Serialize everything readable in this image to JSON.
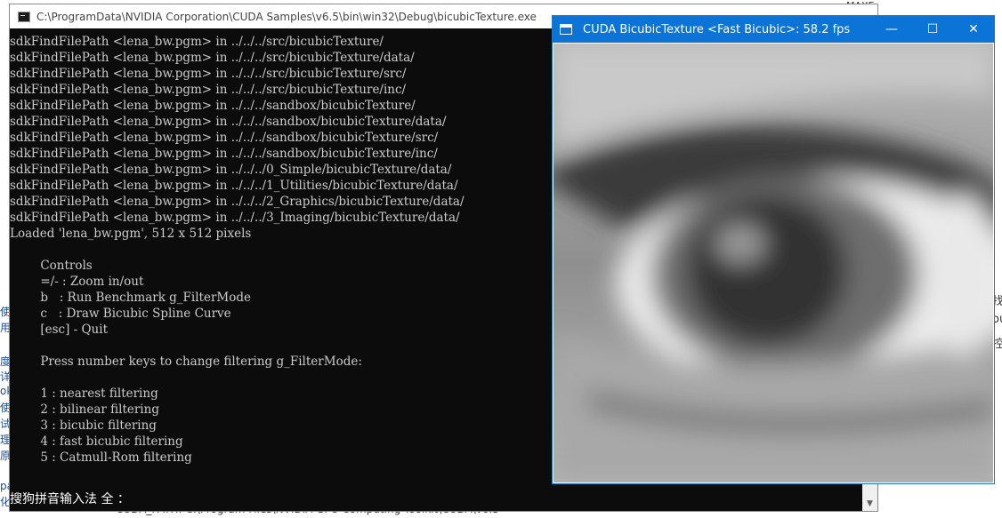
{
  "console": {
    "title": "C:\\ProgramData\\NVIDIA Corporation\\CUDA Samples\\v6.5\\bin\\win32\\Debug\\bicubicTexture.exe",
    "lines": [
      "sdkFindFilePath <lena_bw.pgm> in ../../../src/bicubicTexture/",
      "sdkFindFilePath <lena_bw.pgm> in ../../../src/bicubicTexture/data/",
      "sdkFindFilePath <lena_bw.pgm> in ../../../src/bicubicTexture/src/",
      "sdkFindFilePath <lena_bw.pgm> in ../../../src/bicubicTexture/inc/",
      "sdkFindFilePath <lena_bw.pgm> in ../../../sandbox/bicubicTexture/",
      "sdkFindFilePath <lena_bw.pgm> in ../../../sandbox/bicubicTexture/data/",
      "sdkFindFilePath <lena_bw.pgm> in ../../../sandbox/bicubicTexture/src/",
      "sdkFindFilePath <lena_bw.pgm> in ../../../sandbox/bicubicTexture/inc/",
      "sdkFindFilePath <lena_bw.pgm> in ../../../0_Simple/bicubicTexture/data/",
      "sdkFindFilePath <lena_bw.pgm> in ../../../1_Utilities/bicubicTexture/data/",
      "sdkFindFilePath <lena_bw.pgm> in ../../../2_Graphics/bicubicTexture/data/",
      "sdkFindFilePath <lena_bw.pgm> in ../../../3_Imaging/bicubicTexture/data/",
      "Loaded 'lena_bw.pgm', 512 x 512 pixels",
      "",
      "        Controls",
      "        =/- : Zoom in/out",
      "        b   : Run Benchmark g_FilterMode",
      "        c   : Draw Bicubic Spline Curve",
      "        [esc] - Quit",
      "",
      "        Press number keys to change filtering g_FilterMode:",
      "",
      "        1 : nearest filtering",
      "        2 : bilinear filtering",
      "        3 : bicubic filtering",
      "        4 : fast bicubic filtering",
      "        5 : Catmull-Rom filtering"
    ],
    "ime_status": "搜狗拼音输入法 全 ："
  },
  "cuda_window": {
    "title": "CUDA BicubicTexture <Fast Bicubic>: 58.2 fps",
    "minimize_glyph": "—",
    "maximize_glyph": "☐",
    "close_glyph": "✕"
  },
  "background": {
    "bottom_text": "CUDA_PATH: C:\\Program Files\\NVIDIA GPU Computing Toolkit\\CUDA\\v6.5",
    "left_fragments": [
      "使",
      "用",
      "度",
      "详",
      "ok",
      "使",
      "试",
      "理",
      "原",
      "pa",
      "化"
    ],
    "right_fragments": [
      "找",
      "ou",
      "控"
    ],
    "top_right_fragment": "MAXE"
  },
  "icons": {
    "console_icon": "console-app-icon",
    "cuda_icon": "window-app-icon",
    "scroll_down": "chevron-down-icon"
  }
}
